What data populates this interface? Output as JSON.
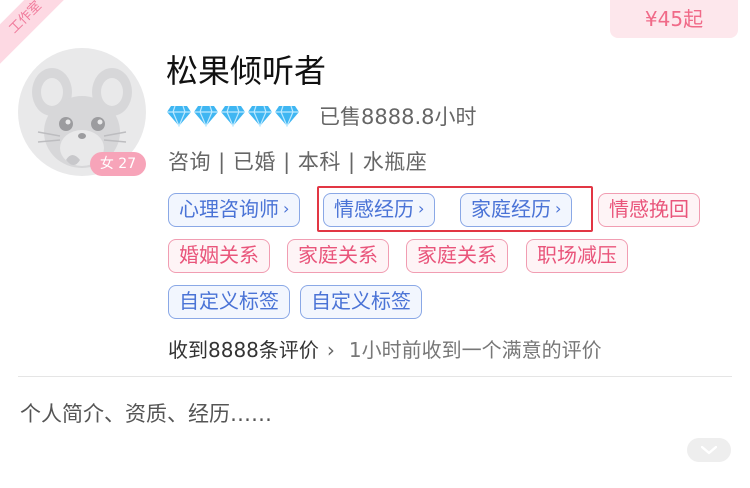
{
  "ribbon": {
    "label": "工作室"
  },
  "price": {
    "label": "¥45起"
  },
  "profile": {
    "name": "松果倾听者",
    "gender_age": "女 27",
    "diamond_count": 5,
    "sold": "已售8888.8小时",
    "info": "咨询 | 已婚 | 本科 | 水瓶座"
  },
  "tags": [
    {
      "label": "心理咨询师",
      "chevron": "›"
    },
    {
      "label": "情感经历",
      "chevron": "›"
    },
    {
      "label": "家庭经历",
      "chevron": "›"
    },
    {
      "label": "情感挽回"
    },
    {
      "label": "婚姻关系"
    },
    {
      "label": "家庭关系"
    },
    {
      "label": "家庭关系"
    },
    {
      "label": "职场减压"
    },
    {
      "label": "自定义标签"
    },
    {
      "label": "自定义标签"
    }
  ],
  "reviews": {
    "count_label": "收到8888条评价",
    "chevron": "›",
    "note": "1小时前收到一个满意的评价"
  },
  "intro": {
    "text": "个人简介、资质、经历……"
  },
  "colors": {
    "accent_pink": "#f06a88",
    "tag_blue": "#4a73d6",
    "tag_pink": "#e9557b",
    "highlight_red": "#e23644",
    "diamond": "#3fb6f2"
  },
  "icons": {
    "avatar": "chinchilla-avatar-icon",
    "diamond": "diamond-icon",
    "expand": "chevron-down-icon"
  }
}
